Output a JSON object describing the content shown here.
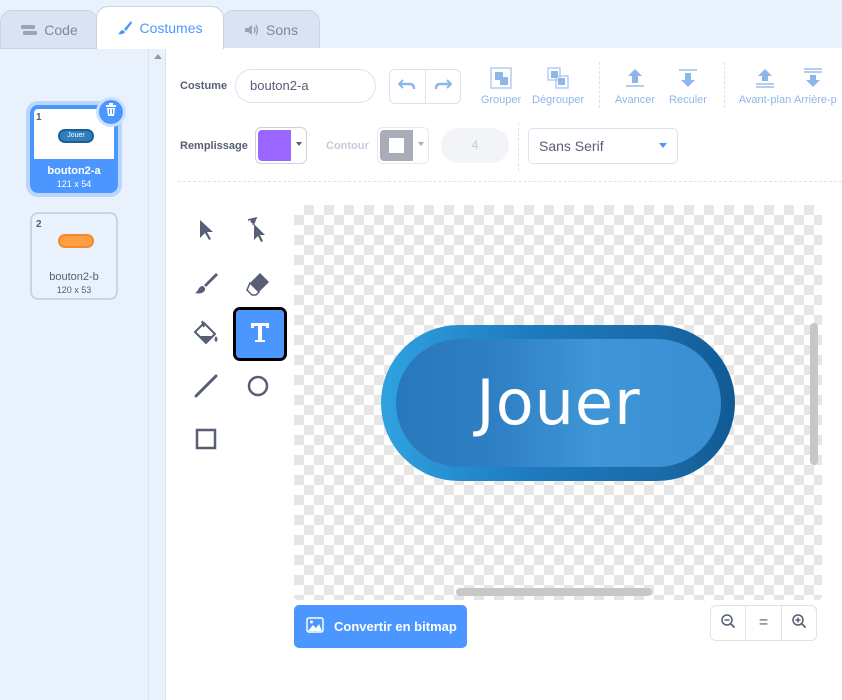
{
  "tabs": [
    {
      "label": "Code",
      "icon": "code-icon"
    },
    {
      "label": "Costumes",
      "icon": "brush-icon"
    },
    {
      "label": "Sons",
      "icon": "speaker-icon"
    }
  ],
  "costumes": [
    {
      "number": "1",
      "name": "bouton2-a",
      "size": "121 x 54",
      "thumb_text": "Jouer",
      "selected": true
    },
    {
      "number": "2",
      "name": "bouton2-b",
      "size": "120 x 53",
      "selected": false
    }
  ],
  "toolbar": {
    "costume_label": "Costume",
    "costume_name": "bouton2-a",
    "group_label": "Grouper",
    "ungroup_label": "Dégrouper",
    "forward_label": "Avancer",
    "backward_label": "Reculer",
    "front_label": "Avant-plan",
    "back_label": "Arrière-p",
    "fill_label": "Remplissage",
    "outline_label": "Contour",
    "outline_width": "4",
    "font": "Sans Serif",
    "fill_color": "#9966ff",
    "outline_color": "#ffffff"
  },
  "canvas": {
    "button_text": "Jouer"
  },
  "bottom": {
    "convert_label": "Convertir en bitmap",
    "zoom_reset": "="
  },
  "colors": {
    "accent": "#4c97ff"
  }
}
